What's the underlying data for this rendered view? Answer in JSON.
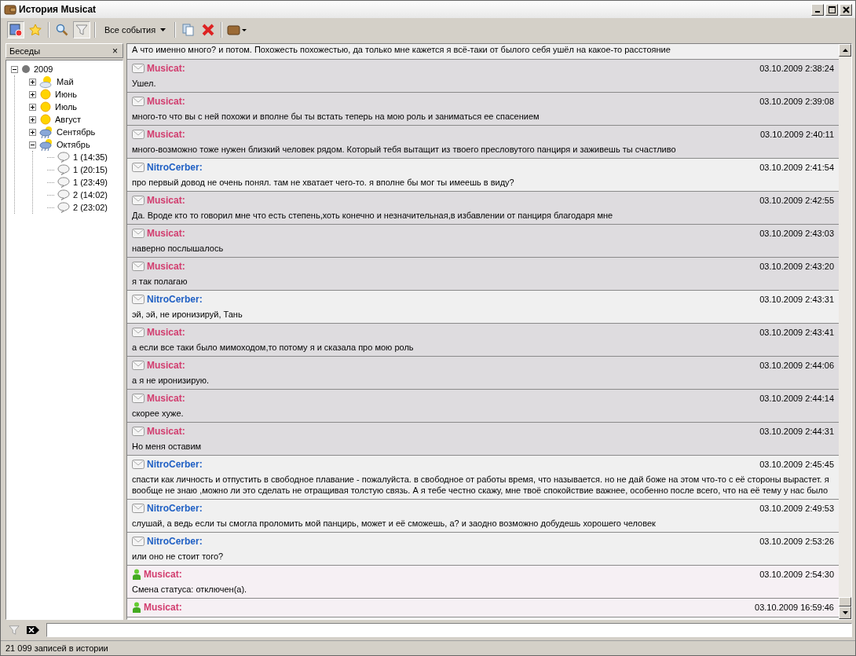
{
  "window": {
    "title": "История Musicat"
  },
  "toolbar": {
    "filter_on": true,
    "events_menu": "Все события"
  },
  "sidebar": {
    "title": "Беседы",
    "close": "×",
    "tree": [
      {
        "label": "2009",
        "kind": "year",
        "expanded": true,
        "children": [
          {
            "label": "Май",
            "kind": "partly-cloudy",
            "expanded": false
          },
          {
            "label": "Июнь",
            "kind": "sunny",
            "expanded": false
          },
          {
            "label": "Июль",
            "kind": "sunny",
            "expanded": false
          },
          {
            "label": "Август",
            "kind": "sunny",
            "expanded": false
          },
          {
            "label": "Сентябрь",
            "kind": "rainy",
            "expanded": false
          },
          {
            "label": "Октябрь",
            "kind": "rainy",
            "expanded": true,
            "children": [
              {
                "label": "1 (14:35)",
                "kind": "chat"
              },
              {
                "label": "1 (20:15)",
                "kind": "chat"
              },
              {
                "label": "1 (23:49)",
                "kind": "chat"
              },
              {
                "label": "2 (14:02)",
                "kind": "chat"
              },
              {
                "label": "2 (23:02)",
                "kind": "chat"
              }
            ]
          }
        ]
      }
    ]
  },
  "messages": [
    {
      "kind": "fragment",
      "outgoing": true,
      "text": "А что именно много? и потом. Похожесть похожестью, да только мне кажется я всё-таки от былого себя ушёл на какое-то расстояние"
    },
    {
      "kind": "message",
      "outgoing": false,
      "author": "Musicat:",
      "time": "03.10.2009 2:38:24",
      "text": "Ушел."
    },
    {
      "kind": "message",
      "outgoing": false,
      "author": "Musicat:",
      "time": "03.10.2009 2:39:08",
      "text": "много-то что вы с ней похожи и вполне бы ты встать теперь на мою роль и заниматься ее спасением"
    },
    {
      "kind": "message",
      "outgoing": false,
      "author": "Musicat:",
      "time": "03.10.2009 2:40:11",
      "text": "много-возможно тоже нужен близкий человек рядом. Который тебя вытащит из твоего пресловутого панциря и заживешь ты счастливо"
    },
    {
      "kind": "message",
      "outgoing": true,
      "author": "NitroCerber:",
      "time": "03.10.2009 2:41:54",
      "text": "про первый довод не очень понял. там не хватает чего-то. я вполне бы мог ты имеешь в виду?"
    },
    {
      "kind": "message",
      "outgoing": false,
      "author": "Musicat:",
      "time": "03.10.2009 2:42:55",
      "text": "Да. Вроде кто то говорил мне что есть степень,хоть конечно и незначительная,в избавлении от панциря благодаря мне"
    },
    {
      "kind": "message",
      "outgoing": false,
      "author": "Musicat:",
      "time": "03.10.2009 2:43:03",
      "text": "наверно послышалось"
    },
    {
      "kind": "message",
      "outgoing": false,
      "author": "Musicat:",
      "time": "03.10.2009 2:43:20",
      "text": "я так полагаю"
    },
    {
      "kind": "message",
      "outgoing": true,
      "author": "NitroCerber:",
      "time": "03.10.2009 2:43:31",
      "text": "эй, эй, не иронизируй, Тань"
    },
    {
      "kind": "message",
      "outgoing": false,
      "author": "Musicat:",
      "time": "03.10.2009 2:43:41",
      "text": "а если все таки было мимоходом,то потому я и сказала про мою роль"
    },
    {
      "kind": "message",
      "outgoing": false,
      "author": "Musicat:",
      "time": "03.10.2009 2:44:06",
      "text": "а я не иронизирую."
    },
    {
      "kind": "message",
      "outgoing": false,
      "author": "Musicat:",
      "time": "03.10.2009 2:44:14",
      "text": "скорее хуже."
    },
    {
      "kind": "message",
      "outgoing": false,
      "author": "Musicat:",
      "time": "03.10.2009 2:44:31",
      "text": "Но меня оставим"
    },
    {
      "kind": "message",
      "outgoing": true,
      "author": "NitroCerber:",
      "time": "03.10.2009 2:45:45",
      "text": "спасти как личность и отпустить в свободное плавание - пожалуйста. в свободное от работы время, что называется. но не дай боже на этом что-то с её стороны вырастет. я вообще не знаю ,можно ли это сделать не отращивая толстую связь. А я тебе честно скажу, мне твоё спокойствие важнее, особенно после всего, что на её тему у нас было"
    },
    {
      "kind": "message",
      "outgoing": true,
      "author": "NitroCerber:",
      "time": "03.10.2009 2:49:53",
      "text": "слушай, а ведь если ты смогла проломить мой панцирь, может и её сможешь, а? и заодно возможно добудешь хорошего человек"
    },
    {
      "kind": "message",
      "outgoing": true,
      "author": "NitroCerber:",
      "time": "03.10.2009 2:53:26",
      "text": "или оно не стоит того?"
    },
    {
      "kind": "status",
      "outgoing": false,
      "author": "Musicat:",
      "time": "03.10.2009 2:54:30",
      "text": "Смена статуса: отключен(а)."
    },
    {
      "kind": "status",
      "outgoing": false,
      "author": "Musicat:",
      "time": "03.10.2009 16:59:46"
    }
  ],
  "status_bar": "21 099 записей в истории"
}
